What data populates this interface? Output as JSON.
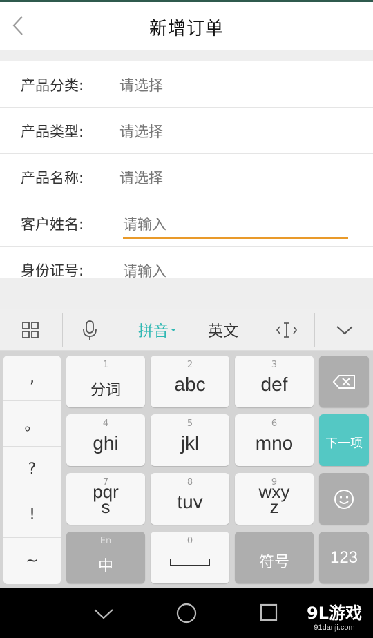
{
  "header": {
    "title": "新增订单"
  },
  "form": {
    "rows": [
      {
        "label": "产品分类:",
        "value": "请选择"
      },
      {
        "label": "产品类型:",
        "value": "请选择"
      },
      {
        "label": "产品名称:",
        "value": "请选择"
      },
      {
        "label": "客户姓名:",
        "placeholder": "请输入"
      },
      {
        "label": "身份证号:",
        "placeholder": "请输入"
      }
    ]
  },
  "keyboard": {
    "toolbar": {
      "pinyin": "拼音",
      "english": "英文"
    },
    "punct": [
      ",",
      "。",
      "?",
      "!",
      "~"
    ],
    "keys": {
      "k1": {
        "num": "1",
        "label": "分词"
      },
      "k2": {
        "num": "2",
        "label": "abc"
      },
      "k3": {
        "num": "3",
        "label": "def"
      },
      "k4": {
        "num": "4",
        "label": "ghi"
      },
      "k5": {
        "num": "5",
        "label": "jkl"
      },
      "k6": {
        "num": "6",
        "label": "mno"
      },
      "k7": {
        "num": "7",
        "label_top": "pqr",
        "label_bottom": "s"
      },
      "k8": {
        "num": "8",
        "label": "tuv"
      },
      "k9": {
        "num": "9",
        "label_top": "wxy",
        "label_bottom": "z"
      },
      "k0": {
        "num": "0"
      },
      "next": "下一项",
      "lang": {
        "small": "En",
        "label": "中"
      },
      "symbol": "符号",
      "numeric": "123"
    },
    "accent_color": "#54c8c4",
    "focus_color": "#e99a2a"
  },
  "watermark": {
    "logo": "9L游戏",
    "url": "91danji.com"
  }
}
